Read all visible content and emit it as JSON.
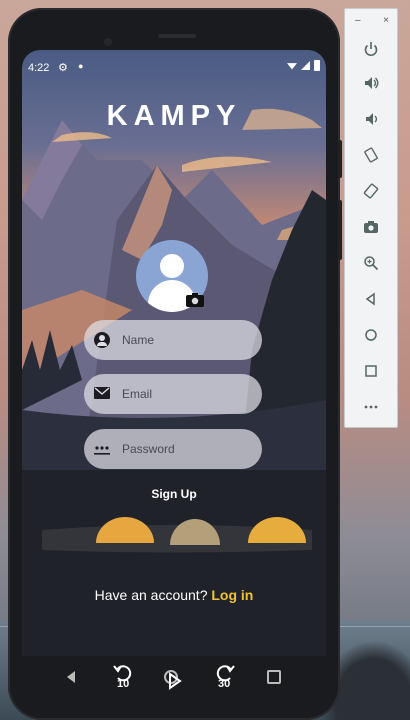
{
  "status_bar": {
    "time": "4:22"
  },
  "app": {
    "logo": "KAMPY",
    "fields": [
      {
        "placeholder": "Name"
      },
      {
        "placeholder": "Email"
      },
      {
        "placeholder": "Password"
      }
    ],
    "signup_label": "Sign Up",
    "have_account_text": "Have an account?",
    "login_label": "Log in"
  },
  "video_controls": {
    "rewind_label": "10",
    "forward_label": "30"
  },
  "toolbar": {
    "minimize_label": "–",
    "close_label": "×",
    "items": [
      "power-icon",
      "volume-up-icon",
      "volume-down-icon",
      "rotate-left-icon",
      "rotate-right-icon",
      "camera-icon",
      "zoom-icon",
      "back-icon",
      "home-icon",
      "overview-icon",
      "more-icon"
    ]
  },
  "colors": {
    "accent": "#f0c430",
    "field_bg": "#e1e1e8",
    "avatar_bg": "#8aa4d4"
  }
}
